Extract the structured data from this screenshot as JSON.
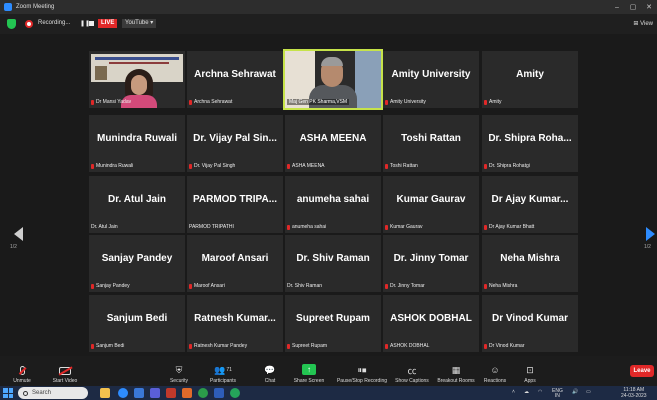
{
  "window": {
    "title": "Zoom Meeting",
    "controls": [
      "–",
      "▢",
      "✕"
    ]
  },
  "topbar": {
    "recording_label": "Recording...",
    "live_label": "LIVE",
    "stream_label": "YouTube ▾",
    "view_label": "⊞ View"
  },
  "gallery": {
    "page_left_label": "1/2",
    "page_right_label": "1/2",
    "tiles": [
      {
        "display": "",
        "nameplate": "Dr Mansi Yadav",
        "muted": true,
        "video": "presenter"
      },
      {
        "display": "Archna Sehrawat",
        "nameplate": "Archna Sehrawat",
        "muted": true
      },
      {
        "display": "",
        "nameplate": "Maj Gen PK Sharma,VSM",
        "muted": false,
        "video": "speaker"
      },
      {
        "display": "Amity University",
        "nameplate": "Amity University",
        "muted": true
      },
      {
        "display": "Amity",
        "nameplate": "Amity",
        "muted": true
      },
      {
        "display": "Munindra Ruwali",
        "nameplate": "Munindra Ruwali",
        "muted": true
      },
      {
        "display": "Dr. Vijay Pal Sin...",
        "nameplate": "Dr. Vijay Pal Singh",
        "muted": true
      },
      {
        "display": "ASHA MEENA",
        "nameplate": "ASHA MEENA",
        "muted": true
      },
      {
        "display": "Toshi Rattan",
        "nameplate": "Toshi Rattan",
        "muted": true
      },
      {
        "display": "Dr. Shipra Roha...",
        "nameplate": "Dr. Shipra Rohatgi",
        "muted": true
      },
      {
        "display": "Dr. Atul Jain",
        "nameplate": "Dr. Atul Jain",
        "muted": false
      },
      {
        "display": "PARMOD TRIPA...",
        "nameplate": "PARMOD TRIPATHI",
        "muted": false
      },
      {
        "display": "anumeha sahai",
        "nameplate": "anumeha sahai",
        "muted": true
      },
      {
        "display": "Kumar Gaurav",
        "nameplate": "Kumar Gaurav",
        "muted": true
      },
      {
        "display": "Dr Ajay Kumar...",
        "nameplate": "Dr Ajay Kumar Bhatt",
        "muted": true
      },
      {
        "display": "Sanjay Pandey",
        "nameplate": "Sanjay Pandey",
        "muted": true
      },
      {
        "display": "Maroof Ansari",
        "nameplate": "Maroof Ansari",
        "muted": true
      },
      {
        "display": "Dr. Shiv Raman",
        "nameplate": "Dr. Shiv Raman",
        "muted": false
      },
      {
        "display": "Dr. Jinny Tomar",
        "nameplate": "Dr. Jinny Tomar",
        "muted": true
      },
      {
        "display": "Neha Mishra",
        "nameplate": "Neha Mishra",
        "muted": true
      },
      {
        "display": "Sanjum Bedi",
        "nameplate": "Sanjum Bedi",
        "muted": true
      },
      {
        "display": "Ratnesh Kumar...",
        "nameplate": "Ratnesh Kumar Pandey",
        "muted": true
      },
      {
        "display": "Supreet Rupam",
        "nameplate": "Supreet Rupam",
        "muted": true
      },
      {
        "display": "ASHOK DOBHAL",
        "nameplate": "ASHOK DOBHAL",
        "muted": true
      },
      {
        "display": "Dr Vinod Kumar",
        "nameplate": "Dr Vinod Kumar",
        "muted": true
      }
    ]
  },
  "toolbar": {
    "unmute": "Unmute",
    "start_video": "Start Video",
    "security": "Security",
    "participants": "Participants",
    "participants_count": "71",
    "chat": "Chat",
    "share_screen": "Share Screen",
    "pause_recording": "Pause/Stop Recording",
    "show_captions": "Show Captions",
    "breakout_rooms": "Breakout Rooms",
    "reactions": "Reactions",
    "apps": "Apps",
    "leave": "Leave"
  },
  "taskbar": {
    "search_placeholder": "Search",
    "language": "ENG",
    "region": "IN",
    "time": "11:18 AM",
    "date": "24-03-2023"
  },
  "colors": {
    "accent": "#2d8cff",
    "live_red": "#e02828",
    "secure_green": "#23c552",
    "active_speaker": "#c6e34a"
  }
}
